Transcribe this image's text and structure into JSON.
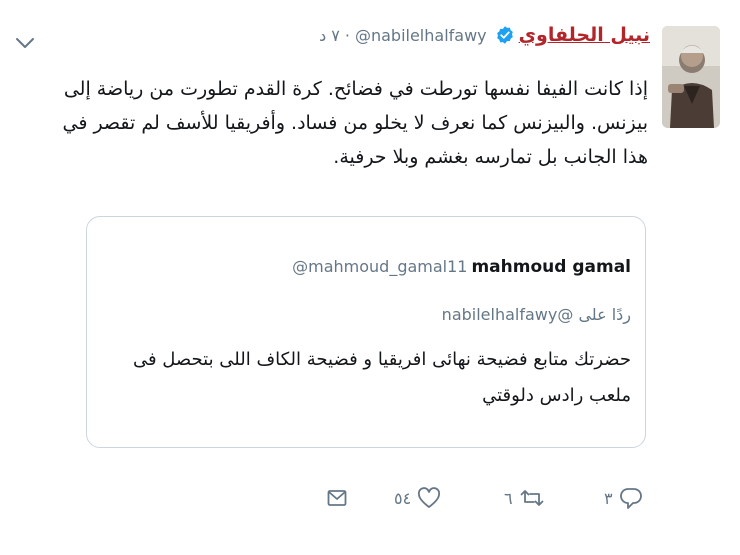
{
  "author": {
    "display_name": "نبيل الحلفاوي",
    "handle": "@nabilelhalfawy",
    "time": "٧ د"
  },
  "tweet_text": "إذا كانت الفيفا نفسها تورطت في فضائح. كرة القدم تطورت من رياضة إلى بيزنس. والبيزنس كما نعرف لا يخلو من فساد. وأفريقيا للأسف لم تقصر في هذا الجانب بل تمارسه بغشم وبلا حرفية.",
  "quoted_tweet": {
    "display_name": "mahmoud gamal",
    "handle": "@mahmoud_gamal11",
    "reply_prefix": "ردًا على",
    "reply_to": "@nabilelhalfawy",
    "text": "حضرتك متابع فضيحة نهائى افريقيا و فضيحة الكاف اللى بتحصل فى ملعب رادس دلوقتي"
  },
  "actions": {
    "reply_count": "٣",
    "retweet_count": "٦",
    "like_count": "٥٤"
  },
  "colors": {
    "name_red": "#b2252a",
    "verified_blue": "#1da1f2",
    "muted": "#657786"
  },
  "icons": [
    "chevron-down-icon",
    "verified-badge-icon",
    "reply-icon",
    "retweet-icon",
    "like-icon",
    "dm-icon"
  ]
}
